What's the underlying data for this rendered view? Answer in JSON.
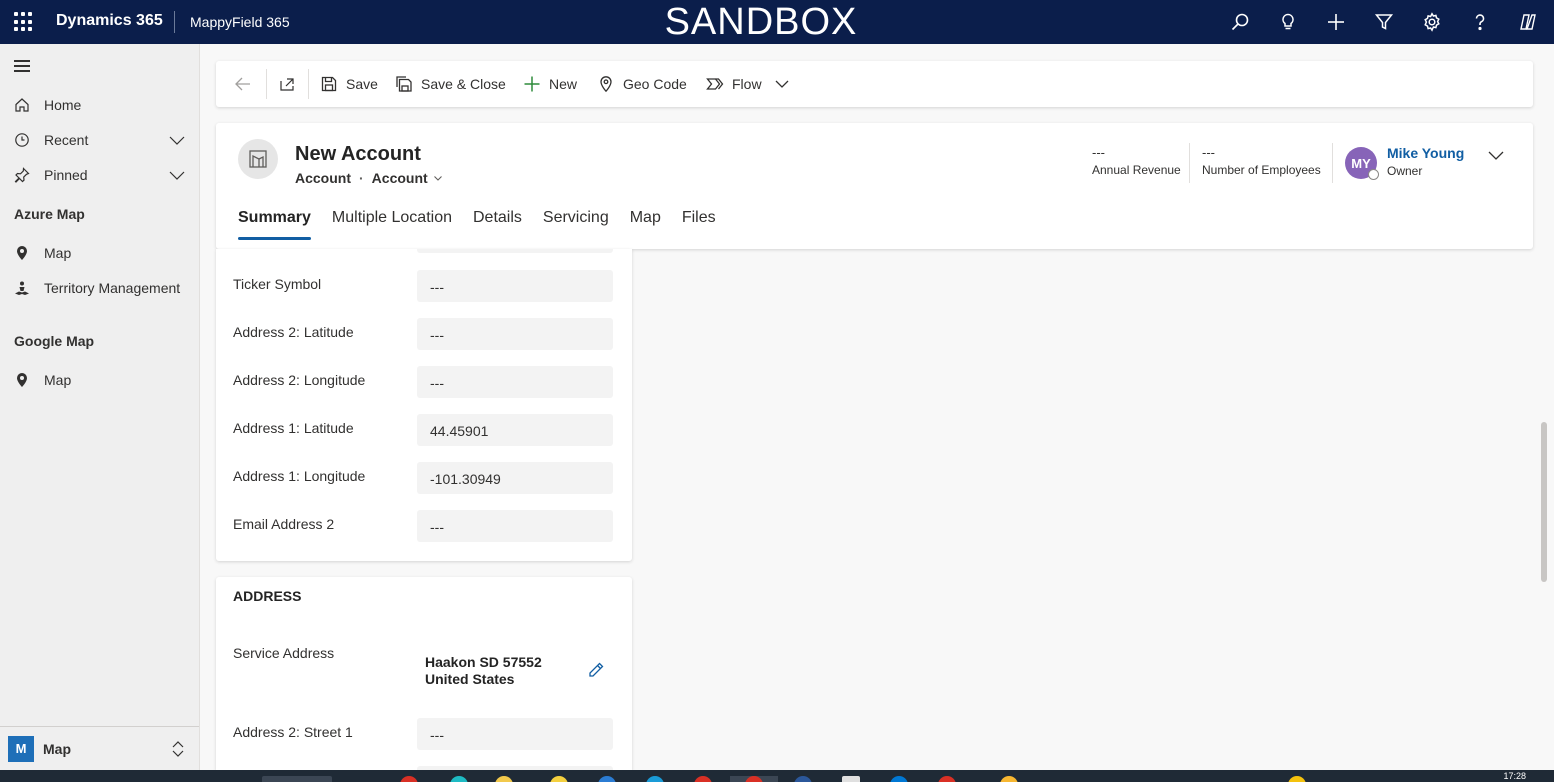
{
  "topbar": {
    "brand": "Dynamics 365",
    "app_name": "MappyField 365",
    "environment_banner": "SANDBOX",
    "icons": [
      "search-icon",
      "lightbulb-icon",
      "plus-icon",
      "filter-icon",
      "gear-icon",
      "help-icon",
      "copilot-icon"
    ]
  },
  "sidebar": {
    "items": [
      {
        "label": "Home",
        "icon": "home-icon"
      },
      {
        "label": "Recent",
        "icon": "clock-icon"
      },
      {
        "label": "Pinned",
        "icon": "pin-icon"
      }
    ],
    "groups": [
      {
        "title": "Azure Map",
        "items": [
          {
            "label": "Map",
            "icon": "map-pin-icon"
          },
          {
            "label": "Territory Management",
            "icon": "territory-icon"
          }
        ]
      },
      {
        "title": "Google Map",
        "items": [
          {
            "label": "Map",
            "icon": "map-pin-icon"
          }
        ]
      }
    ],
    "area": {
      "badge": "M",
      "label": "Map"
    }
  },
  "commandbar": {
    "save": "Save",
    "save_close": "Save & Close",
    "new": "New",
    "geocode": "Geo Code",
    "flow": "Flow"
  },
  "header": {
    "title": "New Account",
    "entity": "Account",
    "form": "Account",
    "fields": [
      {
        "value": "---",
        "label": "Annual Revenue"
      },
      {
        "value": "---",
        "label": "Number of Employees"
      }
    ],
    "owner": {
      "initials": "MY",
      "name": "Mike Young",
      "role": "Owner"
    },
    "tabs": [
      "Summary",
      "Multiple Location",
      "Details",
      "Servicing",
      "Map",
      "Files"
    ],
    "active_tab": "Summary"
  },
  "form": {
    "fields": [
      {
        "label": "Ticker Symbol",
        "value": "---"
      },
      {
        "label": "Address 2: Latitude",
        "value": "---"
      },
      {
        "label": "Address 2: Longitude",
        "value": "---"
      },
      {
        "label": "Address 1: Latitude",
        "value": "44.45901"
      },
      {
        "label": "Address 1: Longitude",
        "value": "-101.30949"
      },
      {
        "label": "Email Address 2",
        "value": "---"
      }
    ],
    "address_section": {
      "title": "ADDRESS",
      "service_address_label": "Service Address",
      "service_address_line1": "Haakon SD 57552",
      "service_address_line2": "United States",
      "street_label": "Address 2: Street 1",
      "street_value": "---"
    }
  },
  "taskbar": {
    "time": "17:28"
  },
  "colors": {
    "topbar": "#0b1e4b",
    "accent": "#115ea3",
    "avatar": "#8764b8",
    "area_badge": "#1e6fb8"
  }
}
